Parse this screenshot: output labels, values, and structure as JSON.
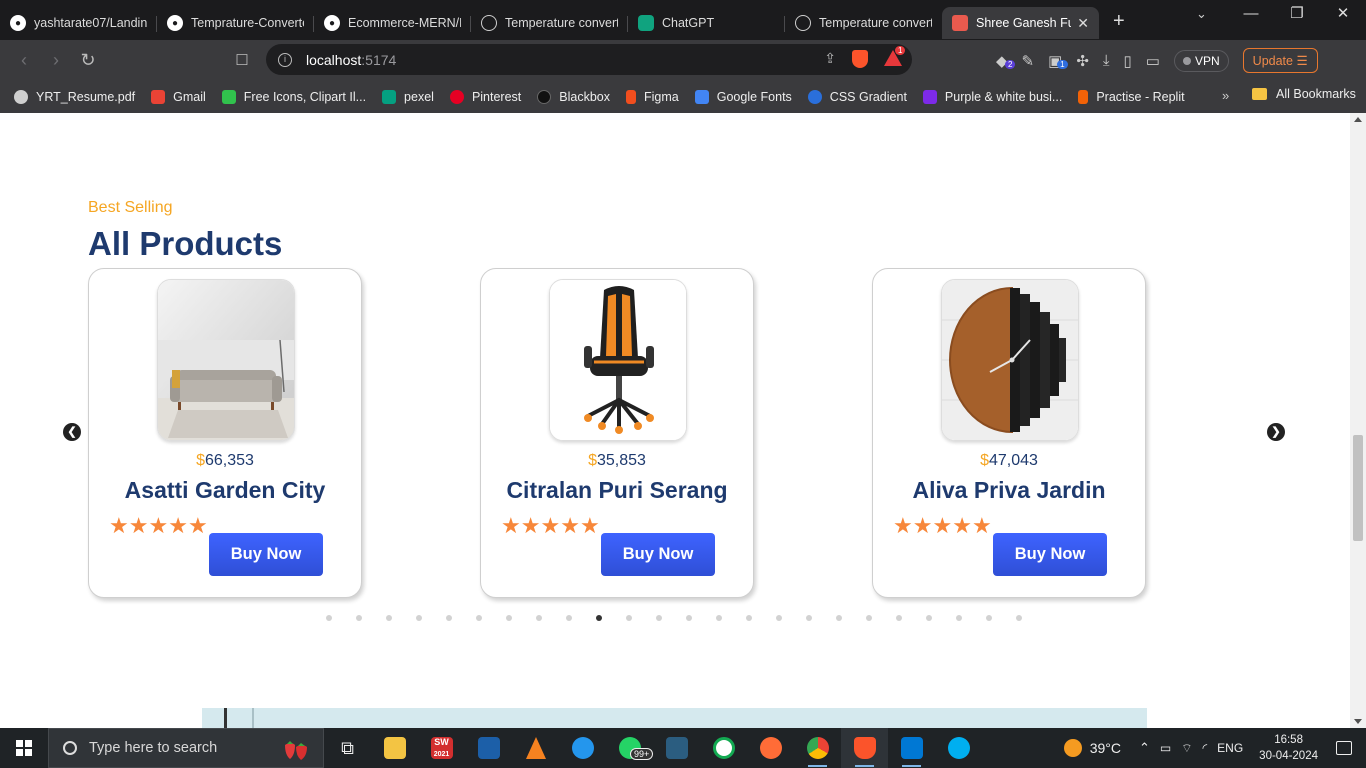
{
  "browser": {
    "tabs": [
      {
        "title": "yashtarate07/Landing",
        "icon": "github-icon"
      },
      {
        "title": "Temprature-Converte",
        "icon": "github-icon"
      },
      {
        "title": "Ecommerce-MERN/R",
        "icon": "github-icon"
      },
      {
        "title": "Temperature convert",
        "icon": "globe-icon"
      },
      {
        "title": "ChatGPT",
        "icon": "chatgpt-icon"
      },
      {
        "title": "Temperature convert",
        "icon": "globe-icon"
      },
      {
        "title": "Shree Ganesh Fu",
        "icon": "shop-icon",
        "active": true
      }
    ],
    "url_host": "localhost",
    "url_port": ":5174",
    "brave_badge": "1",
    "extension_badge": "2",
    "extension_badge_2": "1",
    "vpn_label": "VPN",
    "update_label": "Update",
    "bookmarks": [
      {
        "label": "YRT_Resume.pdf",
        "color": "#cfcfcf"
      },
      {
        "label": "Gmail",
        "color": "#ea4335"
      },
      {
        "label": "Free Icons, Clipart Il...",
        "color": "#31c24d"
      },
      {
        "label": "pexel",
        "color": "#05a081"
      },
      {
        "label": "Pinterest",
        "color": "#e60023"
      },
      {
        "label": "Blackbox",
        "color": "#111111"
      },
      {
        "label": "Figma",
        "color": "#f24e1e"
      },
      {
        "label": "Google Fonts",
        "color": "#4285f4"
      },
      {
        "label": "CSS Gradient",
        "color": "#2a6fdb"
      },
      {
        "label": "Purple & white busi...",
        "color": "#7d2ae8"
      },
      {
        "label": "Practise - Replit",
        "color": "#f26207"
      }
    ],
    "all_bookmarks": "All Bookmarks"
  },
  "page": {
    "eyebrow": "Best Selling",
    "title": "All Products",
    "currency": "$",
    "buy_label": "Buy Now",
    "products": [
      {
        "price": "66,353",
        "name": "Asatti Garden City",
        "rating": 5,
        "image": "sofa-photo"
      },
      {
        "price": "35,853",
        "name": "Citralan Puri Serang",
        "rating": 5,
        "image": "gaming-chair-photo"
      },
      {
        "price": "47,043",
        "name": "Aliva Priva Jardin",
        "rating": 5,
        "image": "wall-clock-photo"
      }
    ],
    "carousel_pages": 24,
    "carousel_active": 9,
    "accent_color": "#f5a623",
    "heading_color": "#1e3a6e",
    "button_color": "#3e63ff"
  },
  "taskbar": {
    "search_placeholder": "Type here to search",
    "whatsapp_badge": "99+",
    "sw_label": "SW",
    "sw_year": "2021",
    "temperature": "39°C",
    "language": "ENG",
    "time": "16:58",
    "date": "30-04-2024"
  }
}
